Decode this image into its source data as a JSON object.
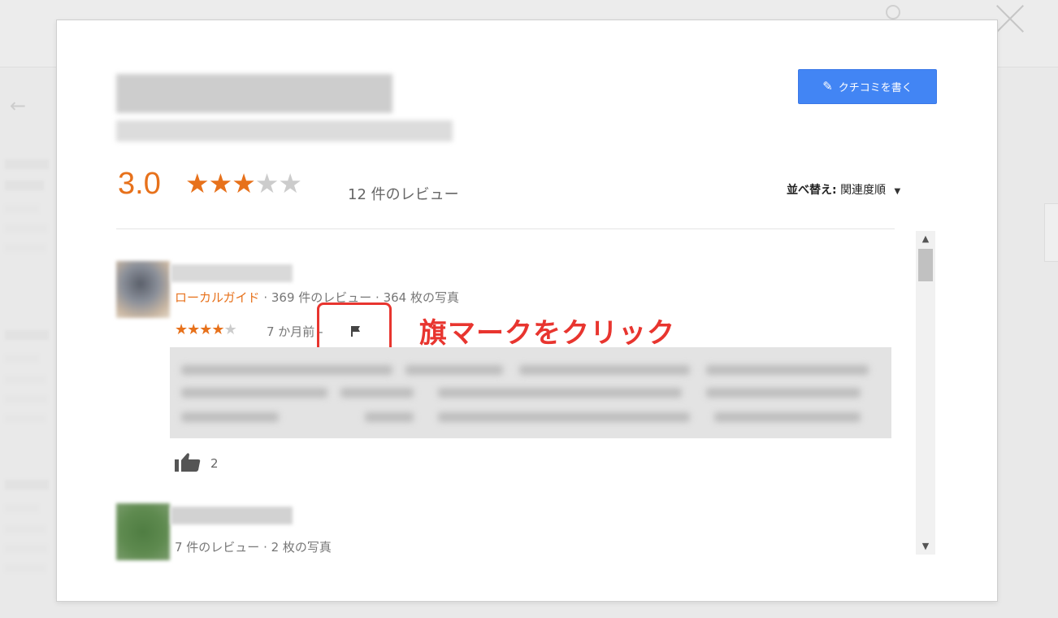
{
  "dialog": {
    "write_review_label": "クチコミを書く",
    "rating_value": "3.0",
    "rating_stars": 3,
    "review_count": "12 件のレビュー",
    "sort_label": "並べ替え:",
    "sort_value": "関連度順"
  },
  "reviews": [
    {
      "badge": "ローカルガイド",
      "meta": " · 369 件のレビュー · 364 枚の写真",
      "stars": 4,
      "time": "7 か月前 -",
      "likes": "2"
    },
    {
      "meta": "7 件のレビュー · 2 枚の写真"
    }
  ],
  "annotation": {
    "text": "旗マークをクリック"
  },
  "colors": {
    "accent_orange": "#e7711b",
    "button_blue": "#4285f4",
    "annotation_red": "#e8352f"
  }
}
